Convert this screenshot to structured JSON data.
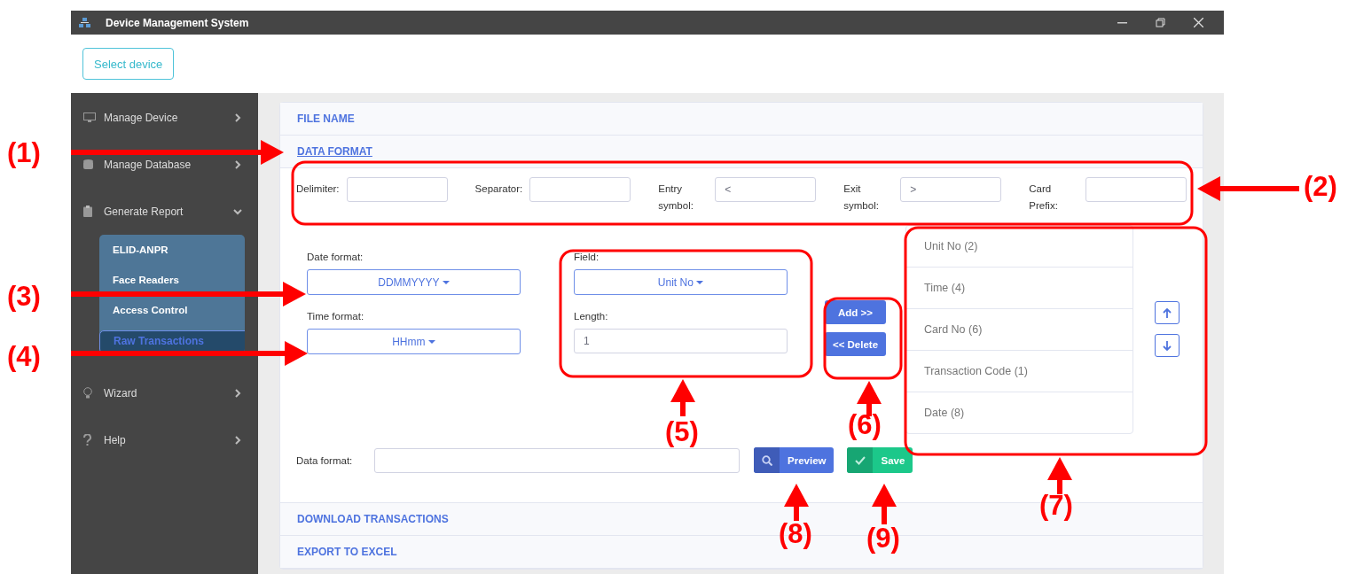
{
  "window": {
    "title": "Device Management System"
  },
  "select_device_button": "Select device",
  "sidebar": {
    "items": [
      {
        "label": "Manage Device",
        "expanded": false
      },
      {
        "label": "Manage Database",
        "expanded": false
      },
      {
        "label": "Generate Report",
        "expanded": true,
        "children": [
          {
            "label": "ELID-ANPR",
            "selected": false
          },
          {
            "label": "Face Readers",
            "selected": false
          },
          {
            "label": "Access Control",
            "selected": false
          },
          {
            "label": "Raw Transactions",
            "selected": true
          }
        ]
      },
      {
        "label": "Wizard",
        "expanded": false
      },
      {
        "label": "Help",
        "expanded": false
      }
    ]
  },
  "sections_before": [
    {
      "title": "FILE NAME",
      "expanded": false
    },
    {
      "title": "DATA FORMAT",
      "expanded": true
    }
  ],
  "symbols": [
    {
      "label": "Delimiter:"
    },
    {
      "label": "Separator:"
    },
    {
      "label": "Entry symbol:",
      "value": "<"
    },
    {
      "label": "Exit symbol:",
      "value": ">"
    },
    {
      "label": "Card Prefix:"
    }
  ],
  "date_format": {
    "label": "Date format:",
    "value": "DDMMYYYY"
  },
  "time_format": {
    "label": "Time format:",
    "value": "HHmm"
  },
  "field": {
    "label": "Field:",
    "value": "Unit No"
  },
  "length": {
    "label": "Length:",
    "value": "1"
  },
  "add_button": "Add >>",
  "delete_button": "<< Delete",
  "field_list": [
    {
      "label": "Unit No (2)"
    },
    {
      "label": "Time (4)"
    },
    {
      "label": "Card No (6)"
    },
    {
      "label": "Transaction Code (1)"
    },
    {
      "label": "Date (8)"
    }
  ],
  "data_format": {
    "label": "Data format:"
  },
  "preview_button": "Preview",
  "save_button": "Save",
  "sections_after": [
    {
      "title": "DOWNLOAD TRANSACTIONS",
      "expanded": false
    },
    {
      "title": "EXPORT TO EXCEL",
      "expanded": false
    }
  ],
  "callouts": [
    "(1)",
    "(2)",
    "(3)",
    "(4)",
    "(5)",
    "(6)",
    "(7)",
    "(8)",
    "(9)"
  ]
}
